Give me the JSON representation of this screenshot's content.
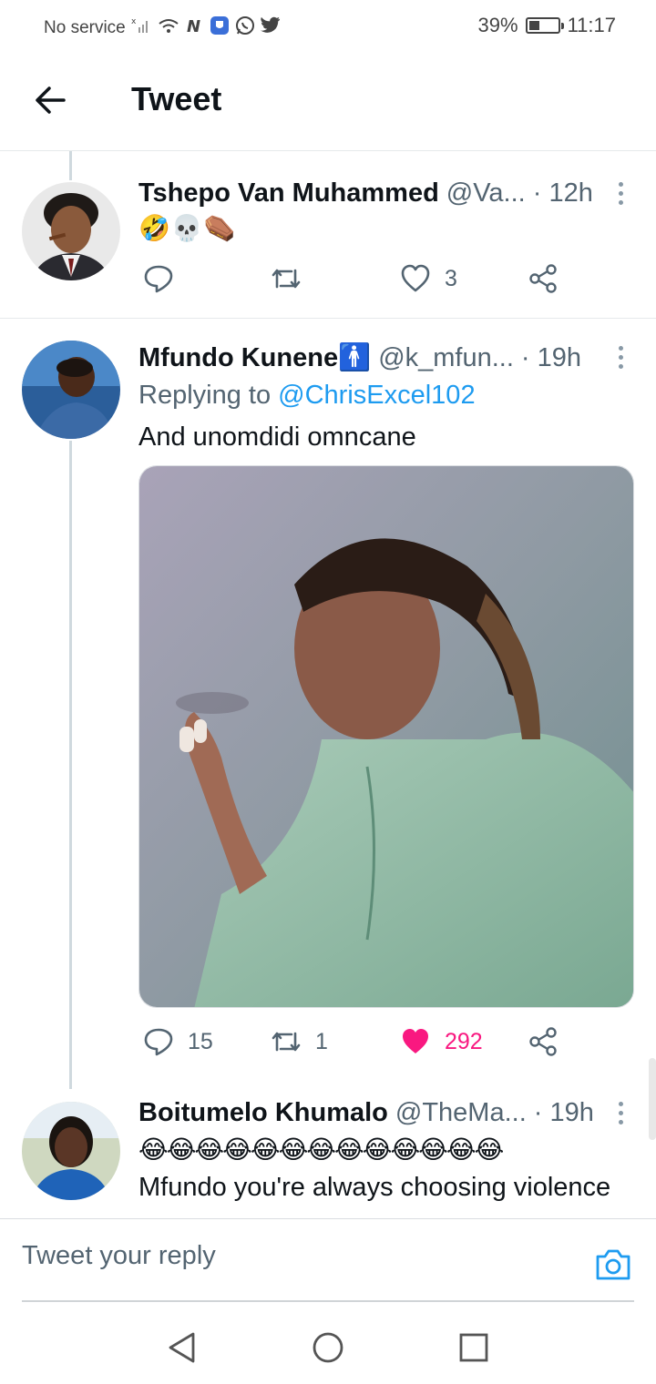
{
  "status_bar": {
    "carrier": "No service",
    "battery": "39%",
    "battery_level": 0.39,
    "time": "11:17"
  },
  "header": {
    "title": "Tweet"
  },
  "tweets": [
    {
      "name": "Tshepo Van Muhammed",
      "handle": "@Va...",
      "time": "· 12h",
      "emojis": "🤣💀⚰️",
      "actions": {
        "reply": "",
        "retweet": "",
        "like": "3"
      }
    },
    {
      "name": "Mfundo Kunene🚹",
      "handle": "@k_mfun...",
      "time": "· 19h",
      "replying_prefix": "Replying to ",
      "replying_mention": "@ChrisExcel102",
      "text": "And unomdidi omncane",
      "actions": {
        "reply": "15",
        "retweet": "1",
        "like": "292"
      },
      "liked": true
    },
    {
      "name": "Boitumelo Khumalo",
      "handle": "@TheMa...",
      "time": "· 19h",
      "emojis": "😂😂😂😂😂😂😂😂😂😂😂😂😂",
      "text": "Mfundo you're always choosing violence"
    }
  ],
  "reply_bar": {
    "placeholder": "Tweet your reply"
  },
  "colors": {
    "accent": "#1d9bf0",
    "like": "#f91880",
    "secondary_text": "#536471"
  }
}
